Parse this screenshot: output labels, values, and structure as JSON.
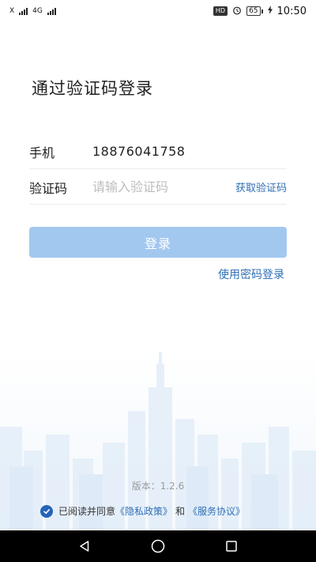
{
  "status_bar": {
    "left_top": "X",
    "left_network": "4G",
    "hd_badge": "HD",
    "battery_level": "65",
    "time": "10:50"
  },
  "login": {
    "title": "通过验证码登录",
    "phone_label": "手机",
    "phone_value": "18876041758",
    "code_label": "验证码",
    "code_placeholder": "请输入验证码",
    "get_code_label": "获取验证码",
    "login_button_label": "登录",
    "password_login_label": "使用密码登录"
  },
  "footer": {
    "version_text": "版本：1.2.6",
    "agree_prefix": "已阅读并同意",
    "privacy_policy_label": "《隐私政策》",
    "and_text": "和",
    "service_agreement_label": "《服务协议》",
    "agreed": true
  },
  "colors": {
    "accent": "#2f6fb6",
    "login_button_bg": "#a3c8ef",
    "checkbox_bg": "#2563b8"
  },
  "nav_bar": {
    "back_icon": "back-triangle-icon",
    "home_icon": "home-circle-icon",
    "recents_icon": "recents-square-icon"
  }
}
